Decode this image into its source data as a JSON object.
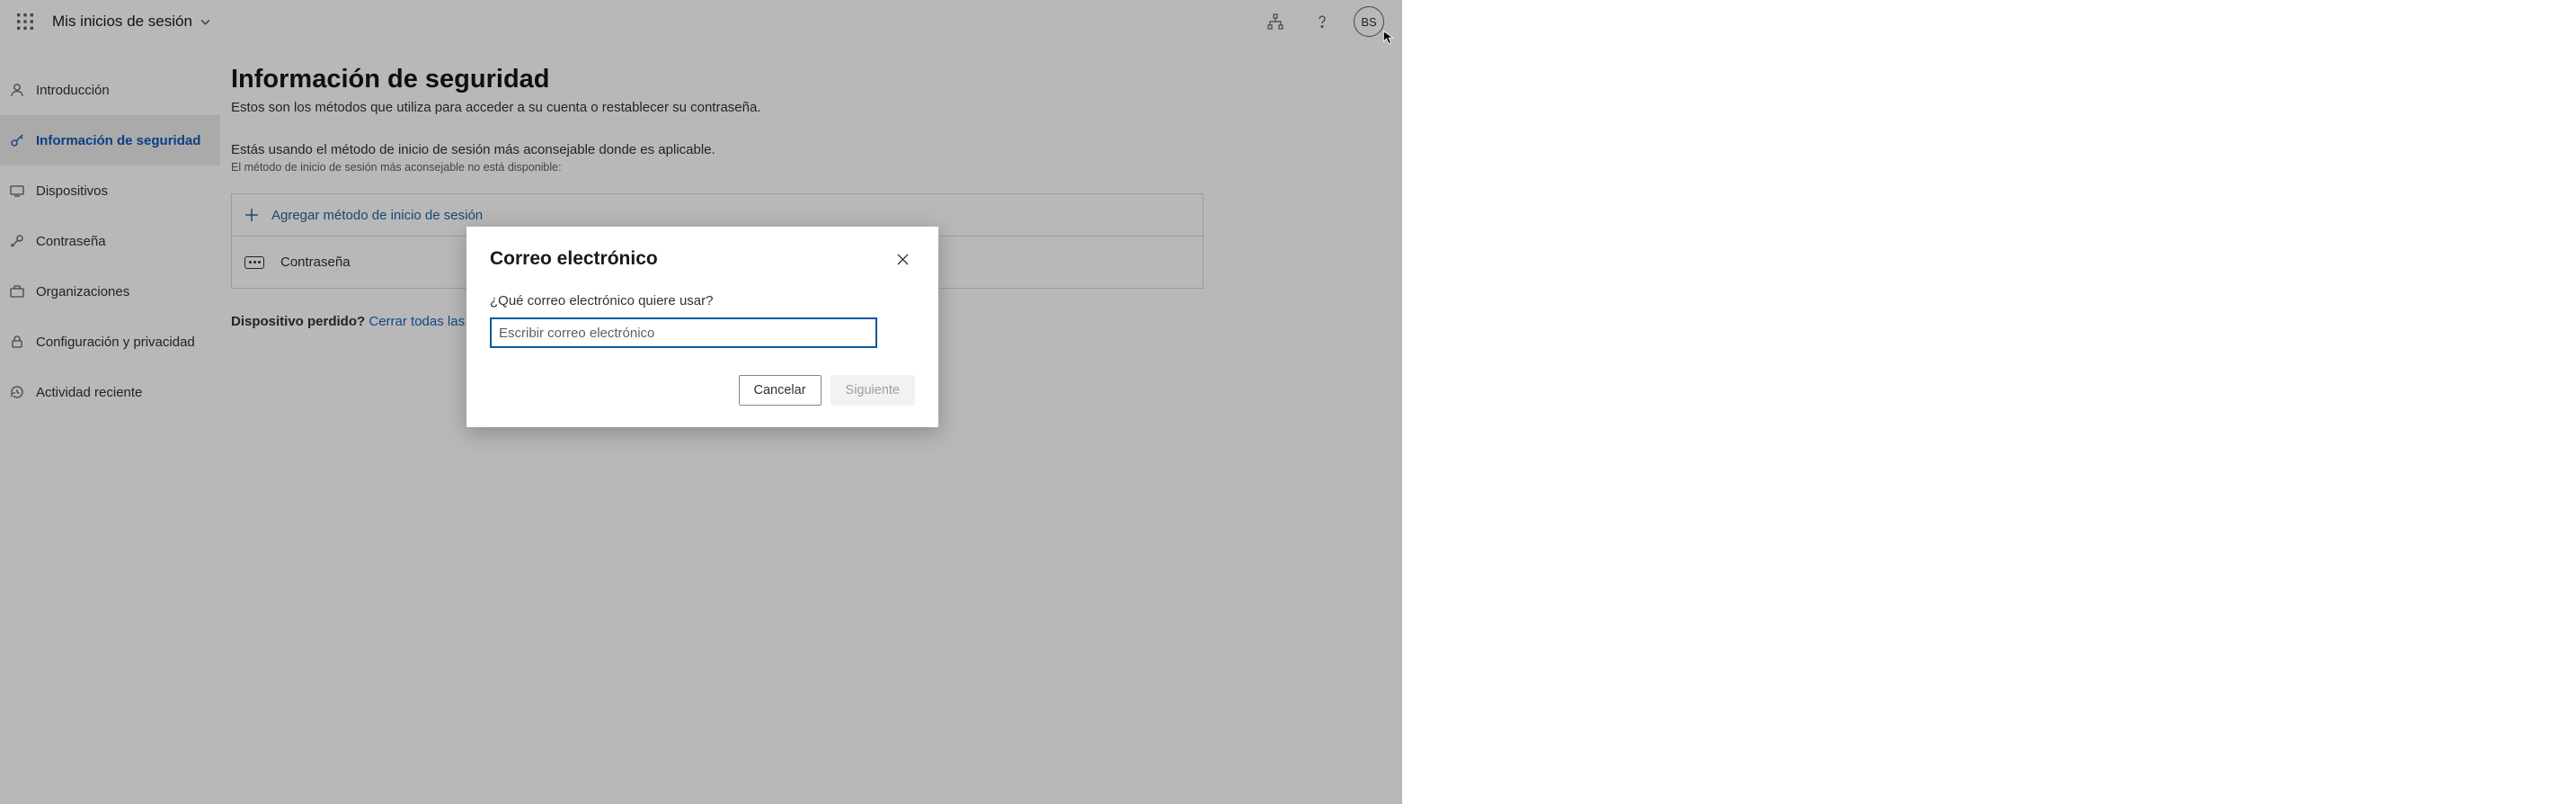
{
  "header": {
    "app_title": "Mis inicios de sesión",
    "avatar_initials": "BS"
  },
  "sidebar": {
    "items": [
      {
        "label": "Introducción"
      },
      {
        "label": "Información de seguridad"
      },
      {
        "label": "Dispositivos"
      },
      {
        "label": "Contraseña"
      },
      {
        "label": "Organizaciones"
      },
      {
        "label": "Configuración y privacidad"
      },
      {
        "label": "Actividad reciente"
      }
    ]
  },
  "main": {
    "title": "Información de seguridad",
    "subtitle": "Estos son los métodos que utiliza para acceder a su cuenta o restablecer su contraseña.",
    "method_heading": "Estás usando el método de inicio de sesión más aconsejable donde es aplicable.",
    "method_note": "El método de inicio de sesión más aconsejable no está disponible:",
    "add_method_label": "Agregar método de inicio de sesión",
    "row1_label": "Contraseña",
    "lost_q": "Dispositivo perdido?",
    "lost_link": "Cerrar todas las sesiones"
  },
  "dialog": {
    "title": "Correo electrónico",
    "label": "¿Qué correo electrónico quiere usar?",
    "placeholder": "Escribir correo electrónico",
    "cancel": "Cancelar",
    "next": "Siguiente"
  }
}
